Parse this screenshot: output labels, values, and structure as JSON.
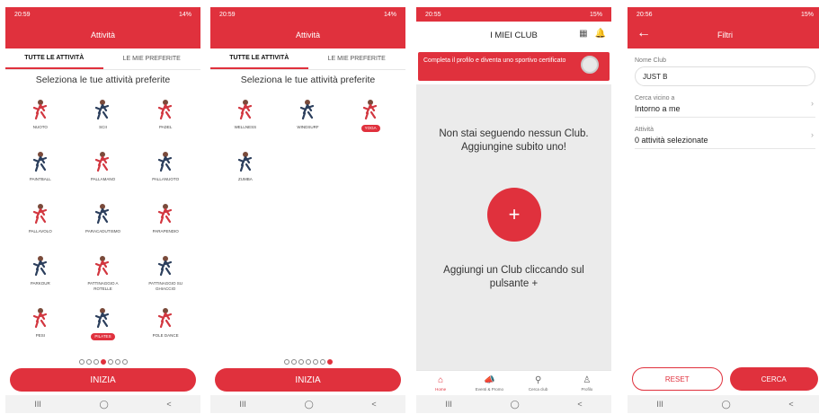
{
  "colors": {
    "accent": "#e0313d"
  },
  "status": {
    "s1": {
      "time": "20:59",
      "right": "14%"
    },
    "s2": {
      "time": "20:59",
      "right": "14%"
    },
    "s3": {
      "time": "20:55",
      "right": "15%"
    },
    "s4": {
      "time": "20:56",
      "right": "15%"
    }
  },
  "nav_buttons": {
    "recents": "III",
    "home": "◯",
    "back": "<"
  },
  "screen1": {
    "title": "Attività",
    "tabs": [
      "TUTTE LE ATTIVITÀ",
      "LE MIE PREFERITE"
    ],
    "subtitle": "Seleziona le tue attività preferite",
    "activities": [
      {
        "label": "NUOTO",
        "icon": "swimming-icon"
      },
      {
        "label": "SCII",
        "icon": "ski-icon"
      },
      {
        "label": "PADEL",
        "icon": "padel-icon"
      },
      {
        "label": "PAINTBALL",
        "icon": "paintball-icon"
      },
      {
        "label": "PALLAMANO",
        "icon": "handball-icon"
      },
      {
        "label": "PALLANUOTO",
        "icon": "waterpolo-icon"
      },
      {
        "label": "PALLAVOLO",
        "icon": "volleyball-icon"
      },
      {
        "label": "PARACADUTISMO",
        "icon": "skydiving-icon"
      },
      {
        "label": "PARAPENDIO",
        "icon": "paragliding-icon"
      },
      {
        "label": "PARKOUR",
        "icon": "parkour-icon"
      },
      {
        "label": "PATTINAGGIO A ROTELLE",
        "icon": "rollerskate-icon"
      },
      {
        "label": "PATTINAGGIO SU GHIACCIO",
        "icon": "iceskate-icon"
      },
      {
        "label": "PESI",
        "icon": "weights-icon"
      },
      {
        "label": "PILATES",
        "icon": "pilates-icon",
        "selected": true
      },
      {
        "label": "POLE DANCE",
        "icon": "poledance-icon"
      }
    ],
    "page_dots": 7,
    "active_dot": 3,
    "button": "INIZIA"
  },
  "screen2": {
    "title": "Attività",
    "tabs": [
      "TUTTE LE ATTIVITÀ",
      "LE MIE PREFERITE"
    ],
    "subtitle": "Seleziona le tue attività preferite",
    "activities": [
      {
        "label": "WELLNESS",
        "icon": "wellness-icon"
      },
      {
        "label": "WINDSURF",
        "icon": "windsurf-icon"
      },
      {
        "label": "YOGA",
        "icon": "yoga-icon",
        "selected": true
      },
      {
        "label": "ZUMBA",
        "icon": "zumba-icon"
      }
    ],
    "page_dots": 7,
    "active_dot": 6,
    "button": "INIZIA"
  },
  "screen3": {
    "title": "I MIEI CLUB",
    "banner": "Completa il profilo e diventa uno sportivo certificato",
    "empty_message": "Non stai seguendo nessun Club. Aggiungine subito uno!",
    "plus": "+",
    "hint": "Aggiungi un Club cliccando sul pulsante +",
    "bottom_nav": [
      {
        "label": "Home",
        "glyph": "⌂",
        "active": true
      },
      {
        "label": "Eventi & Promo",
        "glyph": "📣"
      },
      {
        "label": "Cerca club",
        "glyph": "⚲"
      },
      {
        "label": "Profilo",
        "glyph": "♙"
      }
    ]
  },
  "screen4": {
    "title": "Filtri",
    "back": "←",
    "club_name_label": "Nome Club",
    "club_name_value": "JUST B",
    "near_label": "Cerca vicino a",
    "near_value": "Intorno a me",
    "activity_label": "Attività",
    "activity_value": "0 attività selezionate",
    "reset": "RESET",
    "search": "CERCA"
  }
}
